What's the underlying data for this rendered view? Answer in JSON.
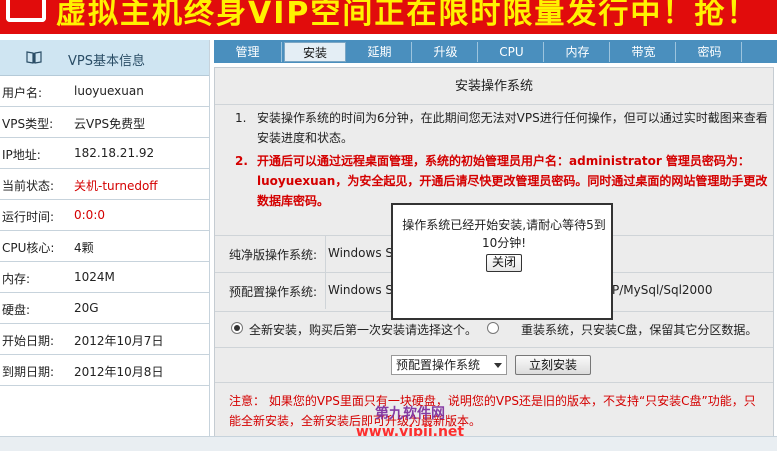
{
  "banner": {
    "text": "虚拟主机终身VIP空间正在限时限量发行中！抢！"
  },
  "sidebar": {
    "title": "VPS基本信息",
    "rows": [
      {
        "label": "用户名:",
        "value": "luoyuexuan"
      },
      {
        "label": "VPS类型:",
        "value": "云VPS免费型"
      },
      {
        "label": "IP地址:",
        "value": "182.18.21.92"
      },
      {
        "label": "当前状态:",
        "value": "关机-turnedoff"
      },
      {
        "label": "运行时间:",
        "value": "0:0:0"
      },
      {
        "label": "CPU核心:",
        "value": "4颗"
      },
      {
        "label": "内存:",
        "value": "1024M"
      },
      {
        "label": "硬盘:",
        "value": "20G"
      },
      {
        "label": "开始日期:",
        "value": "2012年10月7日"
      },
      {
        "label": "到期日期:",
        "value": "2012年10月8日"
      }
    ]
  },
  "tabs": [
    "管理",
    "安装",
    "延期",
    "升级",
    "CPU",
    "内存",
    "带宽",
    "密码"
  ],
  "active_tab": "安装",
  "main": {
    "title": "安装操作系统",
    "note1_num": "1.",
    "note1": "安装操作系统的时间为6分钟，在此期间您无法对VPS进行任何操作，但可以通过实时截图来查看安装进度和状态。",
    "note2_num": "2.",
    "note2": "开通后可以通过远程桌面管理，系统的初始管理员用户名：administrator 管理员密码为：luoyuexuan，为安全起见，开通后请尽快更改管理员密码。同时通过桌面的网站管理助手更改数据库密码。",
    "pure_os_label": "纯净版操作系统:",
    "pure_os_value": "Windows Se",
    "preset_os_label": "预配置操作系统:",
    "preset_os_value": "Windows Se",
    "preset_os_tail": "P/MySql/Sql2000",
    "radio_full": "全新安装，购买后第一次安装请选择这个。",
    "radio_reinstall": "重装系统，只安装C盘，保留其它分区数据。",
    "select_value": "预配置操作系统",
    "install_button": "立刻安装",
    "warning": "注意：   如果您的VPS里面只有一块硬盘，说明您的VPS还是旧的版本，不支持“只安装C盘”功能，只能全新安装，全新安装后即可升级为最新版本。"
  },
  "modal": {
    "message": "操作系统已经开始安装,请耐心等待5到10分钟!",
    "close_label": "关闭"
  },
  "watermark": {
    "line1": "第九软件网",
    "line2": "www.vipjj.net"
  }
}
